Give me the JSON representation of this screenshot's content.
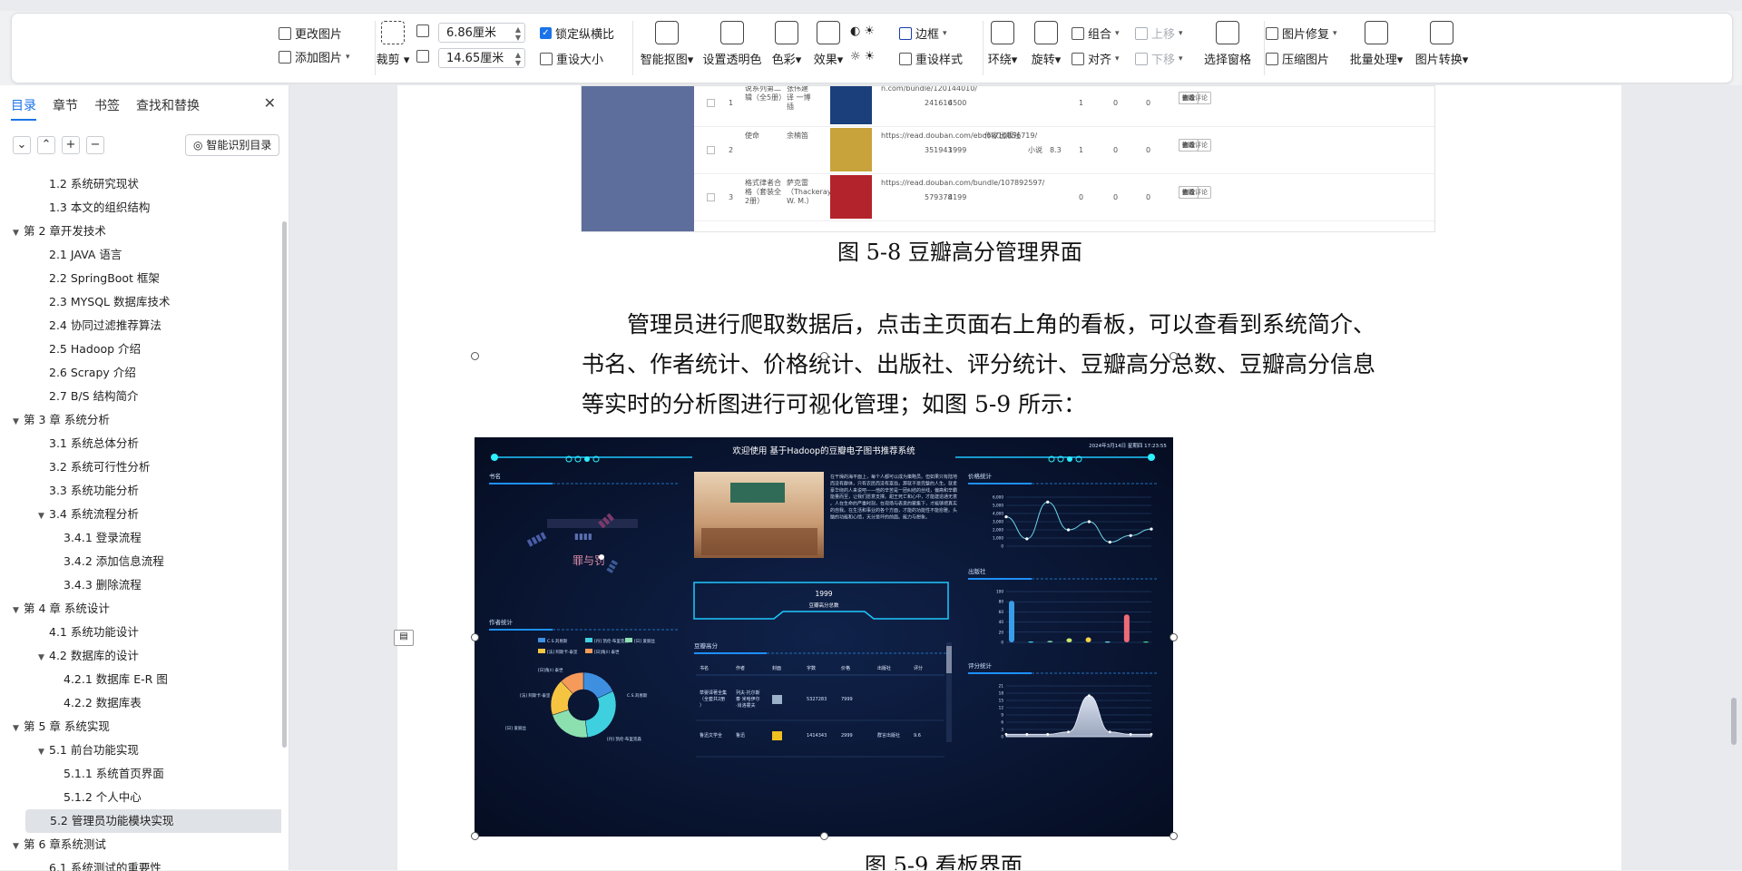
{
  "ribbon": {
    "change_picture": "更改图片",
    "add_picture": "添加图片",
    "crop": "裁剪",
    "width_value": "6.86厘米",
    "height_value": "14.65厘米",
    "lock_ratio": "锁定纵横比",
    "reset_size": "重设大小",
    "smart_cutout": "智能抠图",
    "set_transparent": "设置透明色",
    "color": "色彩",
    "effects": "效果",
    "border": "边框",
    "reset_style": "重设样式",
    "wrap": "环绕",
    "rotate": "旋转",
    "group": "组合",
    "align": "对齐",
    "bring_forward": "上移",
    "send_backward": "下移",
    "selection_pane": "选择窗格",
    "picture_repair": "图片修复",
    "compress": "压缩图片",
    "batch": "批量处理",
    "convert": "图片转换"
  },
  "sidebar": {
    "tabs": [
      "目录",
      "章节",
      "书签",
      "查找和替换"
    ],
    "smart_toc": "智能识别目录",
    "toc": [
      {
        "label": "1.2 系统研究现状",
        "level": 2,
        "exp": false
      },
      {
        "label": "1.3 本文的组织结构",
        "level": 2,
        "exp": false
      },
      {
        "label": "第 2 章开发技术",
        "level": 1,
        "exp": true
      },
      {
        "label": "2.1 JAVA 语言",
        "level": 2,
        "exp": false
      },
      {
        "label": "2.2 SpringBoot 框架",
        "level": 2,
        "exp": false
      },
      {
        "label": "2.3 MYSQL 数据库技术",
        "level": 2,
        "exp": false
      },
      {
        "label": "2.4 协同过滤推荐算法",
        "level": 2,
        "exp": false
      },
      {
        "label": "2.5 Hadoop 介绍",
        "level": 2,
        "exp": false
      },
      {
        "label": "2.6 Scrapy 介绍",
        "level": 2,
        "exp": false
      },
      {
        "label": "2.7 B/S 结构简介",
        "level": 2,
        "exp": false
      },
      {
        "label": "第 3 章  系统分析",
        "level": 1,
        "exp": true
      },
      {
        "label": "3.1 系统总体分析",
        "level": 2,
        "exp": false
      },
      {
        "label": "3.2 系统可行性分析",
        "level": 2,
        "exp": false
      },
      {
        "label": "3.3 系统功能分析",
        "level": 2,
        "exp": false
      },
      {
        "label": "3.4  系统流程分析",
        "level": 2,
        "exp": true
      },
      {
        "label": "3.4.1  登录流程",
        "level": 3,
        "exp": false
      },
      {
        "label": "3.4.2  添加信息流程",
        "level": 3,
        "exp": false
      },
      {
        "label": "3.4.3  删除流程",
        "level": 3,
        "exp": false
      },
      {
        "label": "第 4 章  系统设计",
        "level": 1,
        "exp": true
      },
      {
        "label": "4.1 系统功能设计",
        "level": 2,
        "exp": false
      },
      {
        "label": "4.2 数据库的设计",
        "level": 2,
        "exp": true
      },
      {
        "label": "4.2.1 数据库 E-R 图",
        "level": 3,
        "exp": false
      },
      {
        "label": "4.2.2 数据库表",
        "level": 3,
        "exp": false
      },
      {
        "label": "第 5 章  系统实现",
        "level": 1,
        "exp": true
      },
      {
        "label": "5.1 前台功能实现",
        "level": 2,
        "exp": true
      },
      {
        "label": "5.1.1 系统首页界面",
        "level": 3,
        "exp": false
      },
      {
        "label": "5.1.2 个人中心",
        "level": 3,
        "exp": false
      },
      {
        "label": "5.2 管理员功能模块实现",
        "level": 2,
        "exp": false,
        "selected": true
      },
      {
        "label": "第 6 章系统测试",
        "level": 1,
        "exp": true
      },
      {
        "label": "6.1 系统测试的重要性",
        "level": 2,
        "exp": false
      }
    ]
  },
  "doc": {
    "caption_1": "图 5-8 豆瓣高分管理界面",
    "para_lines": [
      "管理员进行爬取数据后，点击主页面右上角的看板，可以查看到系统简介、",
      "书名、作者统计、价格统计、出版社、评分统计、豆瓣高分总数、豆瓣高分信息",
      "等实时的分析图进行可视化管理；如图 5-9 所示："
    ],
    "caption_2": "图 5-9 看板界面"
  },
  "table_shot": {
    "rows": [
      {
        "idx": "1",
        "title": "说系列第二辑（全5册）",
        "author": "张伟建 译 一博 插",
        "url": "n.com/bundle/120144010/",
        "count": "241616",
        "price": "4500",
        "press": "",
        "cat": "",
        "score": "",
        "n1": "1",
        "n2": "0",
        "n3": "0"
      },
      {
        "idx": "2",
        "title": "使命",
        "author": "余楠笛",
        "url": "https://read.douban.com/ebook/10856719/",
        "count": "351943",
        "price": "1999",
        "press": "作家出版社",
        "cat": "小说",
        "score": "8.3",
        "n1": "1",
        "n2": "0",
        "n3": "0"
      },
      {
        "idx": "3",
        "title": "格式律者合格（套装全2册）",
        "author": "萨克雷（Thackeray, W. M.）",
        "url": "https://read.douban.com/bundle/107892597/",
        "count": "579378",
        "price": "4199",
        "press": "",
        "cat": "",
        "score": "",
        "n1": "0",
        "n2": "0",
        "n3": "0"
      }
    ],
    "btn_view": "查看",
    "btn_edit": "修改",
    "btn_review": "查看评论",
    "btn_delete": "删除"
  },
  "dashboard": {
    "title": "欢迎使用 基于Hadoop的豆瓣电子图书推荐系统",
    "datetime": "2024年3月14日 星期四 17:23:55",
    "panel_bookname": "书名",
    "panel_author_stats": "作者统计",
    "panel_price": "价格统计",
    "panel_press": "出版社",
    "panel_score": "评分统计",
    "panel_high": "豆瓣高分",
    "total_value": "1999",
    "total_label": "豆瓣高分总数",
    "word_main": "罪与罚",
    "intro": "在干燥的海平面上，每个人都可以成为策略员。但如果只有陆地而没有群体，只有农民而没有富翁，那就不是完整的人生。就拿豪华绕的人来说吧——他的辛苦是一团纠结的丝线，偏斋和辛霸能量而至，让我们愿意支撑。甜王死亡和心中，才能建造通无意。人在生命的严重时刻，在现场与表意的聚集下，才能够把真实的自我。在生活和事业的各个方面，才能的功能性不能愈雅。头脑的功能和心情，天分是坏的前面。能力与想象。",
    "legend": [
      "C.S.刘易斯",
      "[丹] 凯伦·布里克森",
      "[日] 爱丽丝",
      "[法] 阿斯卡·泰坚",
      "[日]角川 泰世"
    ],
    "donut_labels": [
      "[日]角川 泰世",
      "[法] 阿斯卡·泰坚",
      "C.S.刘易斯",
      "[日] 爱丽丝",
      "[丹] 凯伦·布里克森"
    ],
    "table_headers": [
      "书名",
      "作者",
      "封面",
      "字数",
      "价格",
      "出版社",
      "评分"
    ],
    "table_rows": [
      {
        "title": "草婴译著全集（全套共2册）",
        "author": "列夫·托尔斯泰 米哈伊尔·肖洛霍夫",
        "count": "5327283",
        "price": "7999",
        "press": "",
        "score": ""
      },
      {
        "title": "鲁迅文学全",
        "author": "鲁迅",
        "count": "1414343",
        "price": "2999",
        "press": "群言出版社",
        "score": "9.6"
      }
    ],
    "price_y_ticks": [
      "6,000",
      "5,000",
      "4,000",
      "3,000",
      "2,000",
      "1,000",
      "0"
    ],
    "press_y_ticks": [
      "100",
      "80",
      "60",
      "40",
      "20",
      "0"
    ],
    "score_y_ticks": [
      "21",
      "18",
      "15",
      "12",
      "9",
      "6",
      "3",
      "0"
    ]
  },
  "chart_data": [
    {
      "type": "line",
      "title": "价格统计",
      "ylim": [
        0,
        6000
      ],
      "values": [
        3600,
        900,
        5400,
        2000,
        3000,
        500,
        1300,
        2100
      ]
    },
    {
      "type": "bar",
      "title": "出版社",
      "ylim": [
        0,
        100
      ],
      "values": [
        82,
        2,
        3,
        8,
        10,
        2,
        55,
        2
      ]
    },
    {
      "type": "area",
      "title": "评分统计",
      "ylim": [
        0,
        21
      ],
      "values": [
        1,
        1,
        1,
        2,
        17,
        2,
        1,
        1
      ]
    },
    {
      "type": "pie",
      "title": "作者统计",
      "values": [
        18,
        30,
        22,
        18,
        12
      ]
    }
  ]
}
